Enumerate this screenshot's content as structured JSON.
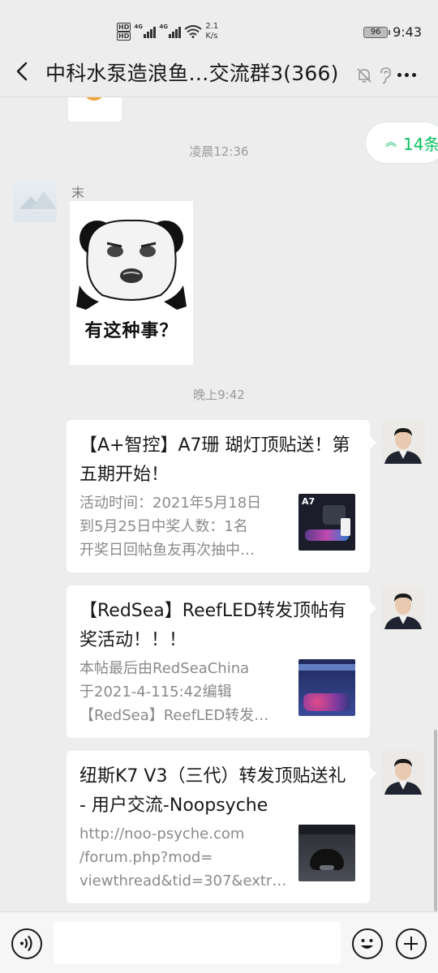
{
  "status_bar": {
    "hd_top": "HD",
    "hd_bottom": "HD",
    "net1": "4G",
    "net2": "4G",
    "speed_value": "2.1",
    "speed_unit": "K/s",
    "battery": "96",
    "time": "9:43"
  },
  "header": {
    "title": "中科水泵造浪鱼…交流群3(366)"
  },
  "chat": {
    "unread_label": "14条",
    "timestamps": [
      "凌晨12:36",
      "晚上9:42"
    ],
    "sender_name": "末",
    "sticker_caption": "有这种事？",
    "cards": [
      {
        "title": "【A+智控】A7珊 瑚灯顶贴送！第五期开始！",
        "desc": "活动时间：2021年5月18日\n到5月25日中奖人数：1名\n开奖日回帖鱼友再次抽中…",
        "thumb_label": "A7"
      },
      {
        "title": "【RedSea】ReefLED转发顶帖有奖活动！！！",
        "desc": "本帖最后由RedSeaChina\n于2021-4-115:42编辑\n【RedSea】ReefLED转发…"
      },
      {
        "title": "纽斯K7 V3（三代）转发顶贴送礼 - 用户交流-Noopsyche",
        "desc": "http://noo-psyche.com\n/forum.php?mod=\nviewthread&tid=307&extr…"
      }
    ]
  },
  "colors": {
    "accent": "#07c160",
    "background": "#ededed",
    "bubble": "#ffffff",
    "timestamp": "#9b9b9b",
    "description": "#8a8a8a"
  },
  "icons": [
    "back-arrow-icon",
    "mute-bell-icon",
    "ear-icon",
    "more-icon",
    "double-chevron-up-icon",
    "voice-icon",
    "emoji-icon",
    "plus-icon"
  ]
}
